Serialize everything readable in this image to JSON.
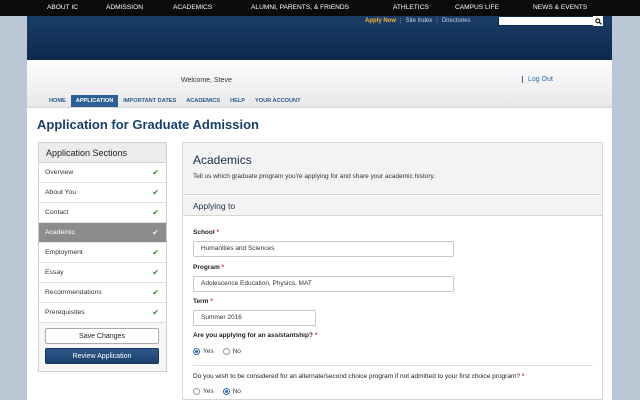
{
  "topnav": {
    "items": [
      "About IC",
      "Admission",
      "Academics",
      "Alumni, Parents, & Friends",
      "Athletics",
      "Campus Life",
      "News & Events"
    ]
  },
  "header": {
    "apply_now": "Apply Now",
    "site_index": "Site Index",
    "directories": "Directories",
    "search_placeholder": ""
  },
  "userbar": {
    "welcome": "Welcome, Steve",
    "logout": "Log Out",
    "tabs": [
      "Home",
      "Application",
      "Important Dates",
      "Academics",
      "Help",
      "Your Account"
    ],
    "active_tab": "Application"
  },
  "page": {
    "title": "Application for Graduate Admission"
  },
  "sidebar": {
    "title": "Application Sections",
    "items": [
      {
        "label": "Overview",
        "complete": true
      },
      {
        "label": "About You",
        "complete": true
      },
      {
        "label": "Contact",
        "complete": true
      },
      {
        "label": "Academic",
        "complete": true
      },
      {
        "label": "Employment",
        "complete": true
      },
      {
        "label": "Essay",
        "complete": true
      },
      {
        "label": "Recommendations",
        "complete": true
      },
      {
        "label": "Prerequisites",
        "complete": true
      }
    ],
    "active_item": "Academic",
    "check_glyph": "✔",
    "save_label": "Save Changes",
    "review_label": "Review Application"
  },
  "panel": {
    "title": "Academics",
    "description": "Tell us which graduate program you're applying for and share your academic history.",
    "section_title": "Applying to",
    "required_mark": "*",
    "fields": {
      "school": {
        "label": "School",
        "value": "Humanities and Sciences"
      },
      "program": {
        "label": "Program",
        "value": "Adolescence Education, Physics, MAT"
      },
      "term": {
        "label": "Term",
        "value": "Summer 2016"
      }
    },
    "assistantship": {
      "question": "Are you applying for an assistantship?",
      "options": [
        "Yes",
        "No"
      ],
      "selected": "Yes"
    },
    "alternate": {
      "question": "Do you wish to be considered for an alternate/second choice program if not admitted to your first choice program?",
      "options": [
        "Yes",
        "No"
      ],
      "selected": "No"
    }
  },
  "colors": {
    "brand_navy": "#0e2a4d",
    "accent_gold": "#f2b632",
    "link_blue": "#2a6bb0",
    "check_green": "#2e8b2e"
  }
}
